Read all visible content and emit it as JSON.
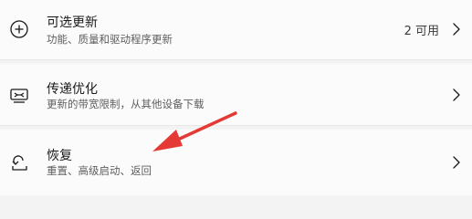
{
  "rows": [
    {
      "title": "可选更新",
      "subtitle": "功能、质量和驱动程序更新",
      "count": "2 可用",
      "icon": "plus-circle-icon"
    },
    {
      "title": "传递优化",
      "subtitle": "更新的带宽限制，从其他设备下载",
      "icon": "delivery-optimization-icon"
    },
    {
      "title": "恢复",
      "subtitle": "重置、高级启动、返回",
      "icon": "recovery-icon"
    }
  ],
  "colors": {
    "row_background": "#fbfbfb",
    "page_background": "#f3f3f3",
    "arrow": "#e53935"
  }
}
